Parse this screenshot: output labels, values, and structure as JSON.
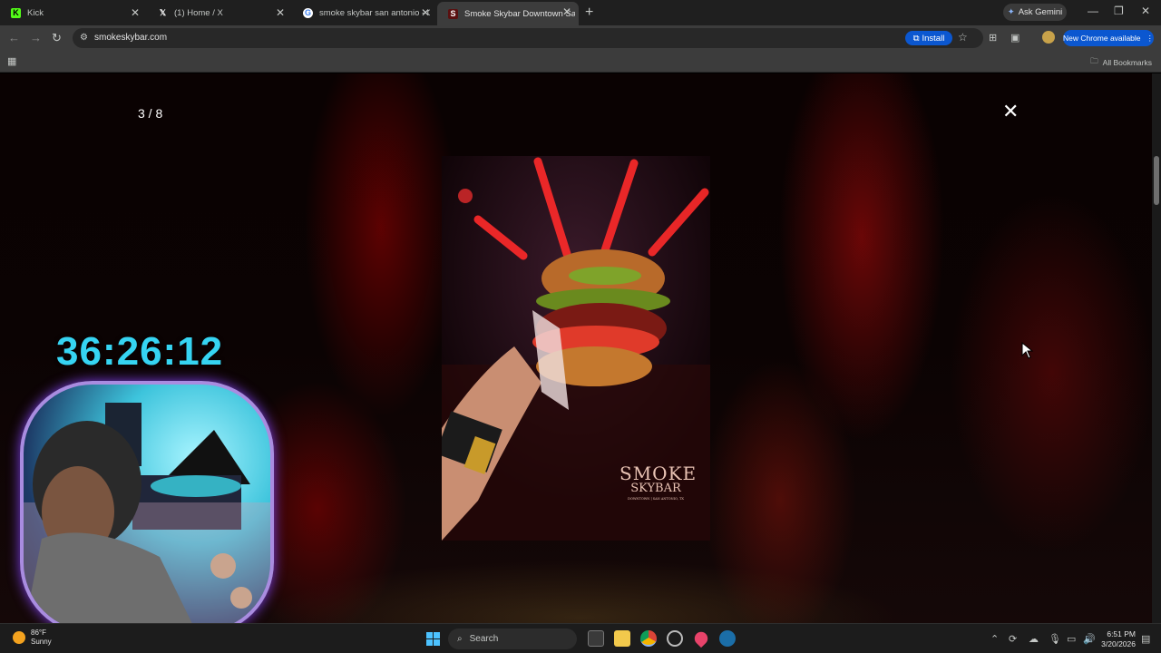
{
  "tabs": [
    {
      "title": "Kick",
      "favicon": "kick-icon",
      "active": false
    },
    {
      "title": "(1) Home / X",
      "favicon": "x-icon",
      "active": false
    },
    {
      "title": "smoke skybar san antonio - Go",
      "favicon": "google-icon",
      "active": false
    },
    {
      "title": "Smoke Skybar Downtown San A",
      "favicon": "smoke-icon",
      "active": true
    }
  ],
  "gemini_label": "Ask Gemini",
  "address": {
    "url": "smokeskybar.com"
  },
  "install_label": "Install",
  "new_chrome_label": "New Chrome available",
  "bookmarks": {
    "all_label": "All Bookmarks"
  },
  "lightbox": {
    "counter": "3 / 8",
    "close_symbol": "✕"
  },
  "photo": {
    "logo_line1": "SMOKE",
    "logo_line2": "SKYBAR",
    "logo_sub": "DOWNTOWN | SAN ANTONIO, TX"
  },
  "overlay": {
    "timer": "36:26:12"
  },
  "taskbar": {
    "weather_temp": "86°F",
    "weather_cond": "Sunny",
    "search_label": "Search",
    "time": "6:51 PM",
    "date": "3/20/2026"
  },
  "colors": {
    "accent": "#0b57d0",
    "timer": "#36d4f2"
  }
}
